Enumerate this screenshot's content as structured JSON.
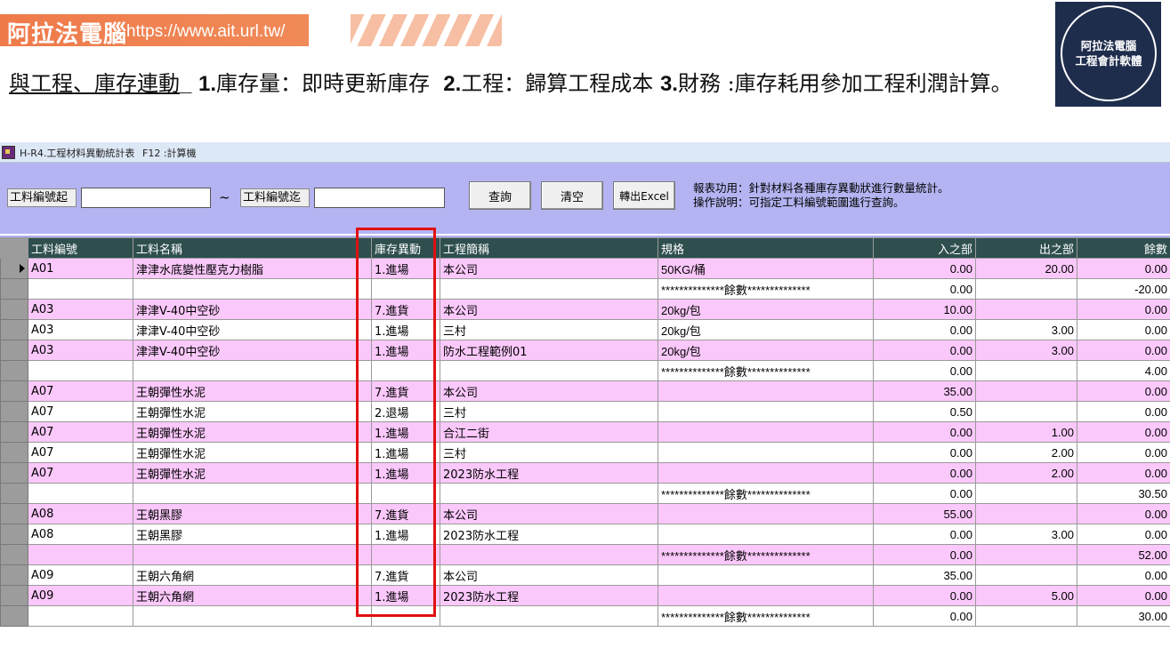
{
  "slide": {
    "brand_name": "阿拉法電腦",
    "brand_url": "https://www.ait.url.tw/",
    "headline_underlined": "與工程、庫存連動",
    "headline_sep": "_",
    "headline_p1_num": "1.",
    "headline_p1_text": "庫存量：即時更新庫存",
    "headline_p2_num": "2.",
    "headline_p2_text": "工程：歸算工程成本",
    "headline_p3_num": "3.",
    "headline_p3_text": "財務 :庫存耗用參加工程利潤計算。",
    "logo_line1": "阿拉法電腦",
    "logo_line2": "工程會計軟體",
    "accent_color": "#ef7a4a",
    "logo_color": "#1f2d4d"
  },
  "window": {
    "title": "H-R4.工程材料異動統計表",
    "shortcut": "F12 :計算機"
  },
  "filters": {
    "from_label": "工料編號起",
    "from_value": "",
    "tilde": "~",
    "to_label": "工料編號迄",
    "to_value": ""
  },
  "buttons": {
    "query": "查詢",
    "clear": "清空",
    "export": "轉出Excel"
  },
  "description": {
    "line1": "報表功用：針對材料各種庫存異動狀進行數量統計。",
    "line2": "操作說明：可指定工料編號範圍進行查詢。"
  },
  "table": {
    "columns": [
      "工料編號",
      "工料名稱",
      "庫存異動",
      "工程簡稱",
      "規格",
      "入之部",
      "出之部",
      "餘數"
    ],
    "rows": [
      {
        "code": "A01",
        "name": "津津水底變性壓克力樹脂",
        "move": "1.進場",
        "project": "本公司",
        "spec": "50KG/桶",
        "in": "0.00",
        "out": "20.00",
        "bal": "0.00",
        "style": "pink"
      },
      {
        "code": "",
        "name": "",
        "move": "",
        "project": "",
        "spec": "**************餘數**************",
        "in": "0.00",
        "out": "",
        "bal": "-20.00",
        "style": "white"
      },
      {
        "code": "A03",
        "name": "津津V-40中空砂",
        "move": "7.進貨",
        "project": "本公司",
        "spec": "20kg/包",
        "in": "10.00",
        "out": "",
        "bal": "0.00",
        "style": "pink"
      },
      {
        "code": "A03",
        "name": "津津V-40中空砂",
        "move": "1.進場",
        "project": "三村",
        "spec": "20kg/包",
        "in": "0.00",
        "out": "3.00",
        "bal": "0.00",
        "style": "white"
      },
      {
        "code": "A03",
        "name": "津津V-40中空砂",
        "move": "1.進場",
        "project": "防水工程範例01",
        "spec": "20kg/包",
        "in": "0.00",
        "out": "3.00",
        "bal": "0.00",
        "style": "pink"
      },
      {
        "code": "",
        "name": "",
        "move": "",
        "project": "",
        "spec": "**************餘數**************",
        "in": "0.00",
        "out": "",
        "bal": "4.00",
        "style": "white"
      },
      {
        "code": "A07",
        "name": "王朝彈性水泥",
        "move": "7.進貨",
        "project": "本公司",
        "spec": "",
        "in": "35.00",
        "out": "",
        "bal": "0.00",
        "style": "pink"
      },
      {
        "code": "A07",
        "name": "王朝彈性水泥",
        "move": "2.退場",
        "project": "三村",
        "spec": "",
        "in": "0.50",
        "out": "",
        "bal": "0.00",
        "style": "white"
      },
      {
        "code": "A07",
        "name": "王朝彈性水泥",
        "move": "1.進場",
        "project": "合江二街",
        "spec": "",
        "in": "0.00",
        "out": "1.00",
        "bal": "0.00",
        "style": "pink"
      },
      {
        "code": "A07",
        "name": "王朝彈性水泥",
        "move": "1.進場",
        "project": "三村",
        "spec": "",
        "in": "0.00",
        "out": "2.00",
        "bal": "0.00",
        "style": "white"
      },
      {
        "code": "A07",
        "name": "王朝彈性水泥",
        "move": "1.進場",
        "project": "2023防水工程",
        "spec": "",
        "in": "0.00",
        "out": "2.00",
        "bal": "0.00",
        "style": "pink"
      },
      {
        "code": "",
        "name": "",
        "move": "",
        "project": "",
        "spec": "**************餘數**************",
        "in": "0.00",
        "out": "",
        "bal": "30.50",
        "style": "white"
      },
      {
        "code": "A08",
        "name": "王朝黑膠",
        "move": "7.進貨",
        "project": "本公司",
        "spec": "",
        "in": "55.00",
        "out": "",
        "bal": "0.00",
        "style": "pink"
      },
      {
        "code": "A08",
        "name": "王朝黑膠",
        "move": "1.進場",
        "project": "2023防水工程",
        "spec": "",
        "in": "0.00",
        "out": "3.00",
        "bal": "0.00",
        "style": "white"
      },
      {
        "code": "",
        "name": "",
        "move": "",
        "project": "",
        "spec": "**************餘數**************",
        "in": "0.00",
        "out": "",
        "bal": "52.00",
        "style": "pink"
      },
      {
        "code": "A09",
        "name": "王朝六角網",
        "move": "7.進貨",
        "project": "本公司",
        "spec": "",
        "in": "35.00",
        "out": "",
        "bal": "0.00",
        "style": "white"
      },
      {
        "code": "A09",
        "name": "王朝六角網",
        "move": "1.進場",
        "project": "2023防水工程",
        "spec": "",
        "in": "0.00",
        "out": "5.00",
        "bal": "0.00",
        "style": "pink"
      },
      {
        "code": "",
        "name": "",
        "move": "",
        "project": "",
        "spec": "**************餘數**************",
        "in": "0.00",
        "out": "",
        "bal": "30.00",
        "style": "white"
      }
    ]
  }
}
